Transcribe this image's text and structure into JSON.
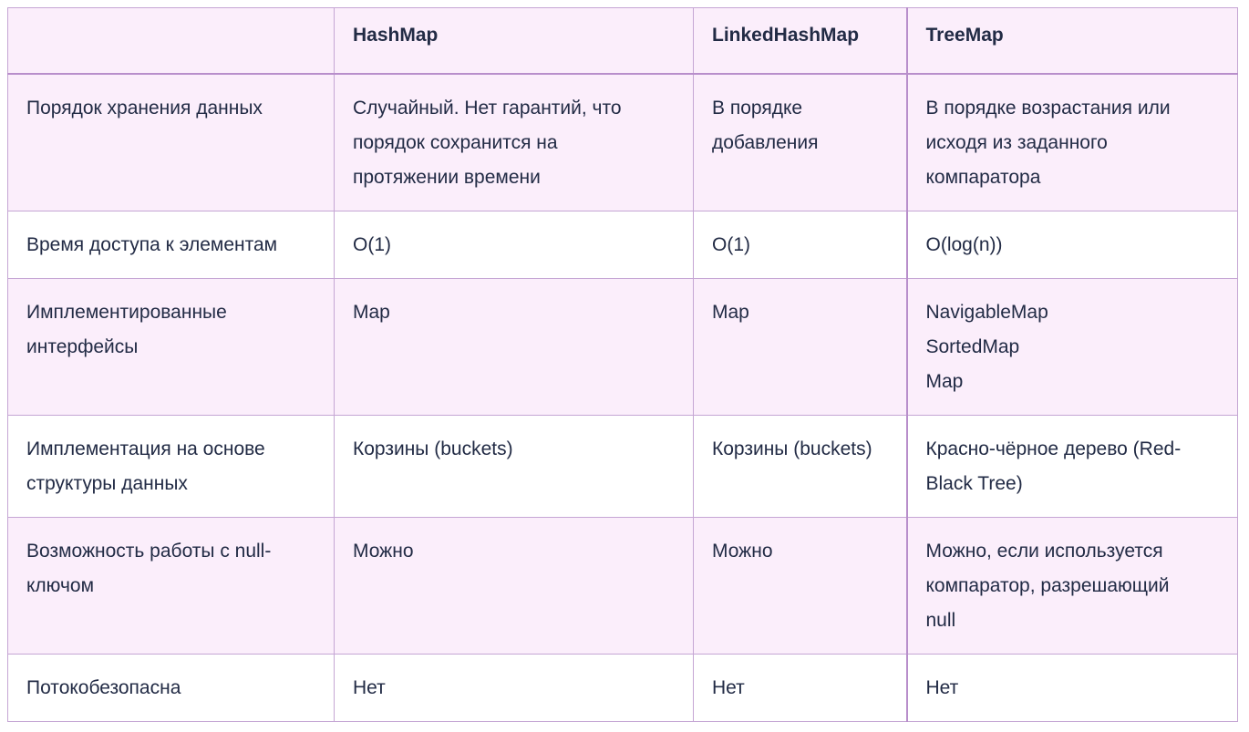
{
  "table": {
    "headers": [
      "",
      "HashMap",
      "LinkedHashMap",
      "TreeMap"
    ],
    "rows": [
      {
        "feature": "Порядок хранения данных",
        "hashmap": "Случайный. Нет гарантий, что порядок сохранится на протяжении времени",
        "linkedhashmap": "В порядке добавления",
        "treemap": "В порядке возрастания или исходя из заданного компаратора"
      },
      {
        "feature": "Время доступа к элементам",
        "hashmap": "O(1)",
        "linkedhashmap": "O(1)",
        "treemap": "O(log(n))"
      },
      {
        "feature": "Имплементированные интерфейсы",
        "hashmap": "Map",
        "linkedhashmap": "Map",
        "treemap_lines": [
          "NavigableMap",
          "SortedMap",
          "Map"
        ]
      },
      {
        "feature": "Имплементация на основе структуры данных",
        "hashmap": "Корзины (buckets)",
        "linkedhashmap": "Корзины (buckets)",
        "treemap": "Красно-чёрное дерево (Red-Black Tree)"
      },
      {
        "feature": "Возможность работы с null-ключом",
        "hashmap": "Можно",
        "linkedhashmap": "Можно",
        "treemap": "Можно, если используется компаратор, разрешающий null"
      },
      {
        "feature": "Потокобезопасна",
        "hashmap": "Нет",
        "linkedhashmap": "Нет",
        "treemap": "Нет"
      }
    ]
  }
}
